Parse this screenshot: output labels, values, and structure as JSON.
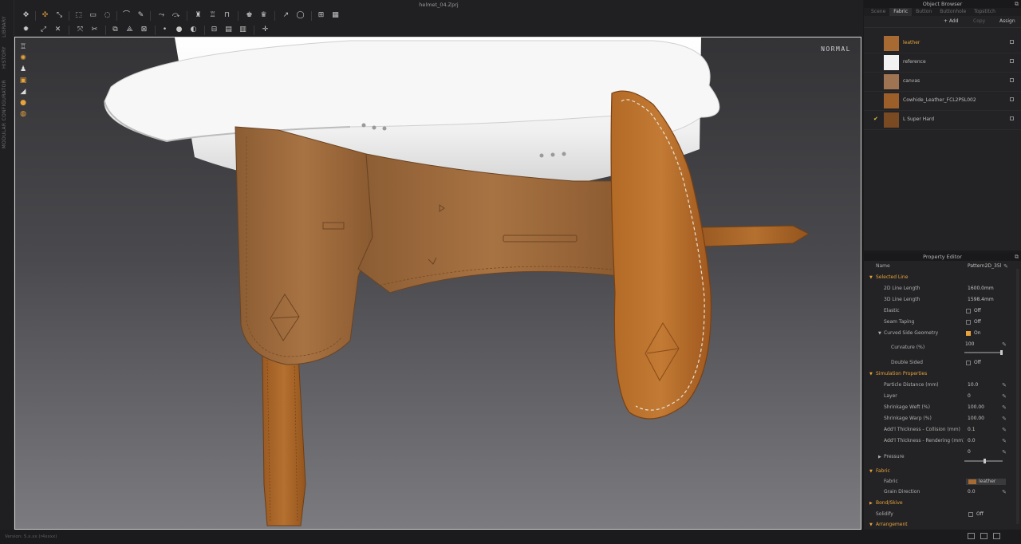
{
  "window": {
    "doc_title": "helmet_04.Zprj",
    "view_mode": "NORMAL",
    "version": "Version: 5.x.xx (r4xxxx)"
  },
  "side_rail": {
    "labels": [
      "LIBRARY",
      "HISTORY",
      "MODULAR CONFIGURATOR"
    ]
  },
  "object_browser": {
    "title": "Object Browser",
    "tabs": [
      "Scene",
      "Fabric",
      "Button",
      "Buttonhole",
      "Topstitch"
    ],
    "active_tab": "Fabric",
    "actions": {
      "add": "+ Add",
      "copy": "Copy",
      "assign": "Assign"
    },
    "fabrics": [
      {
        "name": "leather",
        "color": "#a76a32",
        "active": true,
        "checked": false
      },
      {
        "name": "reference",
        "color": "#f2f2f2",
        "active": false,
        "checked": false
      },
      {
        "name": "canvas",
        "color": "#9e7452",
        "active": false,
        "checked": false
      },
      {
        "name": "Cowhide_Leather_FCL2PSL002",
        "color": "#9c5f2a",
        "active": false,
        "checked": false
      },
      {
        "name": "L Super Hard",
        "color": "#7a4a22",
        "active": false,
        "checked": true
      }
    ]
  },
  "property_editor": {
    "title": "Property Editor",
    "name_label": "Name",
    "name_value": "Pattern2D_35l",
    "selected_line": {
      "header": "Selected Line",
      "line_2d_label": "2D Line Length",
      "line_2d_value": "1600.0mm",
      "line_3d_label": "3D Line Length",
      "line_3d_value": "1598.4mm",
      "elastic_label": "Elastic",
      "elastic_value": "Off",
      "seam_label": "Seam Taping",
      "seam_value": "Off",
      "curved_label": "Curved Side Geometry",
      "curved_value": "On",
      "curvature_label": "Curvature (%)",
      "curvature_value": "100",
      "double_label": "Double Sided",
      "double_value": "Off"
    },
    "simulation": {
      "header": "Simulation Properties",
      "particle_label": "Particle Distance (mm)",
      "particle_value": "10.0",
      "layer_label": "Layer",
      "layer_value": "0",
      "weft_label": "Shrinkage Weft (%)",
      "weft_value": "100.00",
      "warp_label": "Shrinkage Warp (%)",
      "warp_value": "100.00",
      "thick_col_label": "Add'l Thickness - Collision (mm)",
      "thick_col_value": "0.1",
      "thick_ren_label": "Add'l Thickness - Rendering (mm)",
      "thick_ren_value": "0.0",
      "pressure_label": "Pressure",
      "pressure_value": "0"
    },
    "fabric": {
      "header": "Fabric",
      "fabric_label": "Fabric",
      "fabric_value": "leather",
      "grain_label": "Grain Direction",
      "grain_value": "0.0"
    },
    "bond_header": "Bond/Skive",
    "solidify_label": "Solidify",
    "solidify_value": "Off",
    "arrangement_header": "Arrangement"
  },
  "colors": {
    "accent": "#e8a33a",
    "leather": "#a76a32",
    "stitch": "#e9e2d3",
    "panel_bg": "#232325"
  }
}
